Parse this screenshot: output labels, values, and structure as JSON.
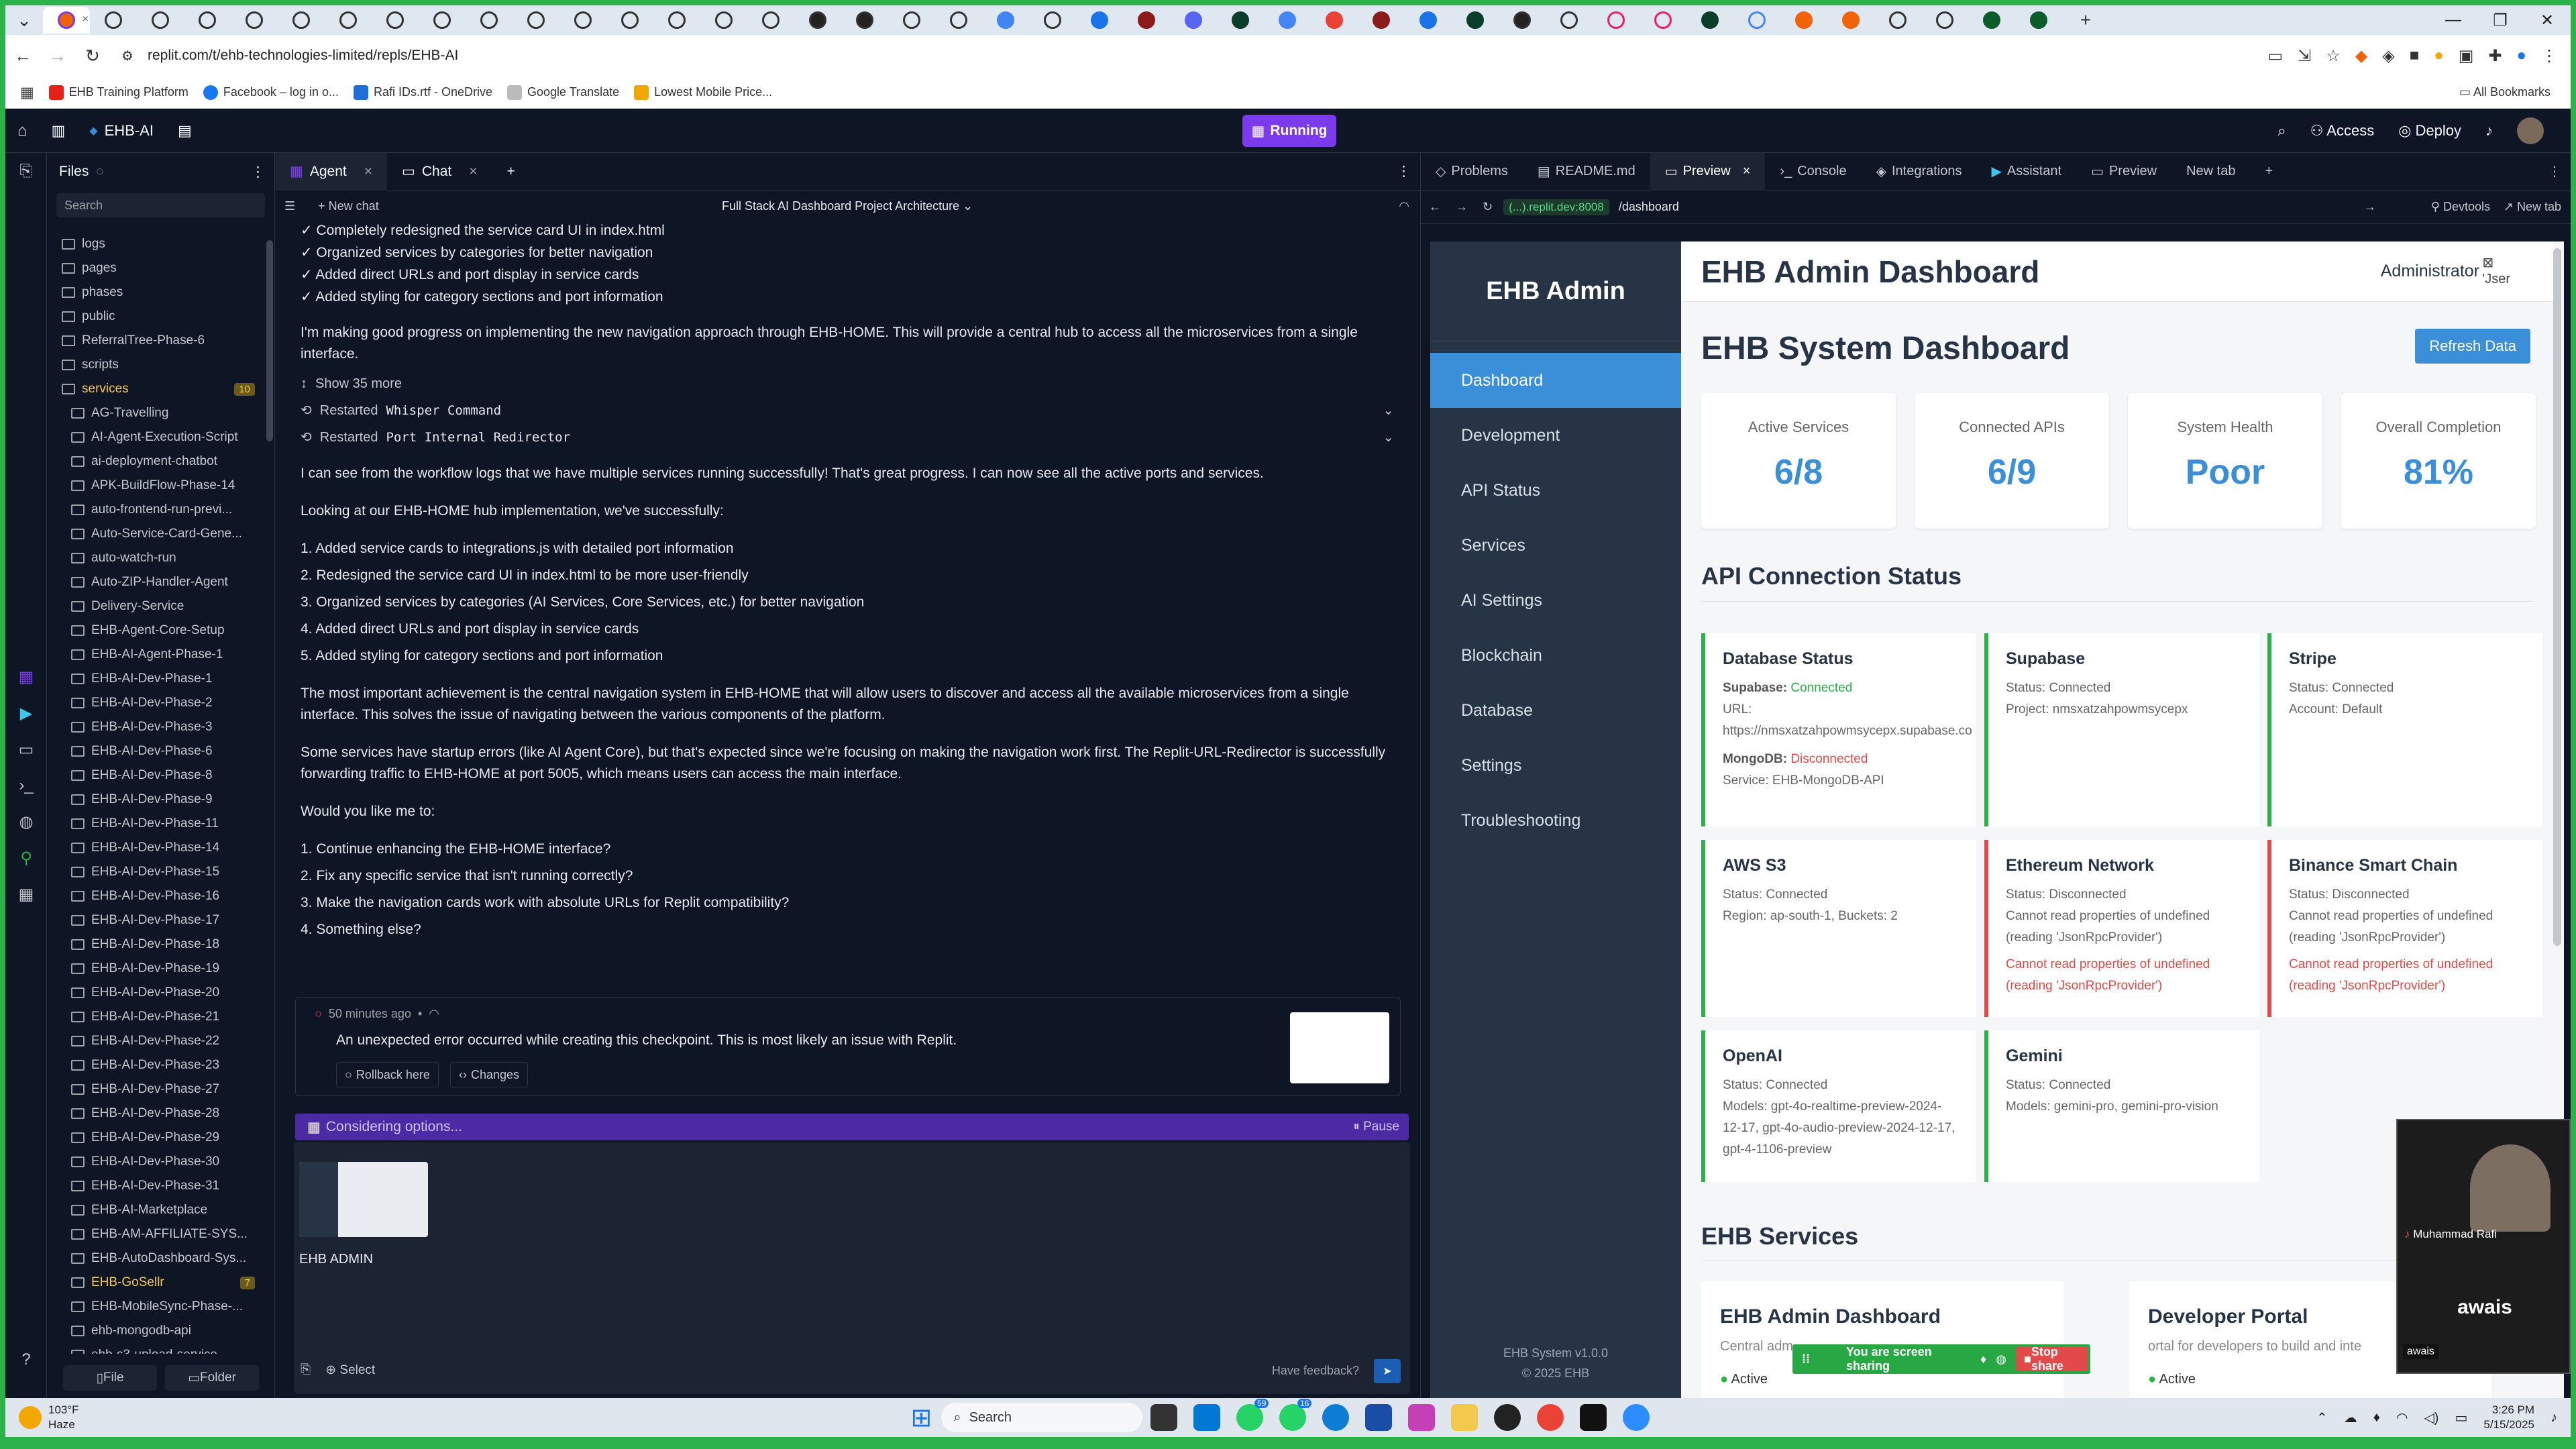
{
  "browser": {
    "url": "replit.com/t/ehb-technologies-limited/repls/EHB-AI",
    "bookmarks": [
      "EHB Training Platform",
      "Facebook – log in o...",
      "Rafi IDs.rtf - OneDrive",
      "Google Translate",
      "Lowest Mobile Price..."
    ],
    "all_bookmarks": "All Bookmarks"
  },
  "replit": {
    "project": "EHB-AI",
    "run_status": "Running",
    "access": "Access",
    "deploy": "Deploy"
  },
  "files": {
    "title": "Files",
    "search_placeholder": "Search",
    "file_btn": "File",
    "folder_btn": "Folder",
    "items": [
      {
        "name": "logs",
        "depth": 0
      },
      {
        "name": "pages",
        "depth": 0
      },
      {
        "name": "phases",
        "depth": 0
      },
      {
        "name": "public",
        "depth": 0
      },
      {
        "name": "ReferralTree-Phase-6",
        "depth": 0
      },
      {
        "name": "scripts",
        "depth": 0
      },
      {
        "name": "services",
        "depth": 0,
        "badge": "10",
        "highlight": true
      },
      {
        "name": "AG-Travelling",
        "depth": 1
      },
      {
        "name": "AI-Agent-Execution-Script",
        "depth": 1
      },
      {
        "name": "ai-deployment-chatbot",
        "depth": 1
      },
      {
        "name": "APK-BuildFlow-Phase-14",
        "depth": 1
      },
      {
        "name": "auto-frontend-run-previ...",
        "depth": 1
      },
      {
        "name": "Auto-Service-Card-Gene...",
        "depth": 1
      },
      {
        "name": "auto-watch-run",
        "depth": 1
      },
      {
        "name": "Auto-ZIP-Handler-Agent",
        "depth": 1
      },
      {
        "name": "Delivery-Service",
        "depth": 1
      },
      {
        "name": "EHB-Agent-Core-Setup",
        "depth": 1
      },
      {
        "name": "EHB-AI-Agent-Phase-1",
        "depth": 1
      },
      {
        "name": "EHB-AI-Dev-Phase-1",
        "depth": 1
      },
      {
        "name": "EHB-AI-Dev-Phase-2",
        "depth": 1
      },
      {
        "name": "EHB-AI-Dev-Phase-3",
        "depth": 1
      },
      {
        "name": "EHB-AI-Dev-Phase-6",
        "depth": 1
      },
      {
        "name": "EHB-AI-Dev-Phase-8",
        "depth": 1
      },
      {
        "name": "EHB-AI-Dev-Phase-9",
        "depth": 1
      },
      {
        "name": "EHB-AI-Dev-Phase-11",
        "depth": 1
      },
      {
        "name": "EHB-AI-Dev-Phase-14",
        "depth": 1
      },
      {
        "name": "EHB-AI-Dev-Phase-15",
        "depth": 1
      },
      {
        "name": "EHB-AI-Dev-Phase-16",
        "depth": 1
      },
      {
        "name": "EHB-AI-Dev-Phase-17",
        "depth": 1
      },
      {
        "name": "EHB-AI-Dev-Phase-18",
        "depth": 1
      },
      {
        "name": "EHB-AI-Dev-Phase-19",
        "depth": 1
      },
      {
        "name": "EHB-AI-Dev-Phase-20",
        "depth": 1
      },
      {
        "name": "EHB-AI-Dev-Phase-21",
        "depth": 1
      },
      {
        "name": "EHB-AI-Dev-Phase-22",
        "depth": 1
      },
      {
        "name": "EHB-AI-Dev-Phase-23",
        "depth": 1
      },
      {
        "name": "EHB-AI-Dev-Phase-27",
        "depth": 1
      },
      {
        "name": "EHB-AI-Dev-Phase-28",
        "depth": 1
      },
      {
        "name": "EHB-AI-Dev-Phase-29",
        "depth": 1
      },
      {
        "name": "EHB-AI-Dev-Phase-30",
        "depth": 1
      },
      {
        "name": "EHB-AI-Dev-Phase-31",
        "depth": 1
      },
      {
        "name": "EHB-AI-Marketplace",
        "depth": 1
      },
      {
        "name": "EHB-AM-AFFILIATE-SYS...",
        "depth": 1
      },
      {
        "name": "EHB-AutoDashboard-Sys...",
        "depth": 1
      },
      {
        "name": "EHB-GoSellr",
        "depth": 1,
        "badge": "7",
        "highlight": true
      },
      {
        "name": "EHB-MobileSync-Phase-...",
        "depth": 1
      },
      {
        "name": "ehb-mongodb-api",
        "depth": 1
      },
      {
        "name": "ehb-s3-upload-service",
        "depth": 1
      }
    ]
  },
  "agent": {
    "tab_agent": "Agent",
    "tab_chat": "Chat",
    "new_chat": "New chat",
    "thread_title": "Full Stack AI Dashboard Project Architecture",
    "checks": [
      "✓ Completely redesigned the service card UI in index.html",
      "✓ Organized services by categories for better navigation",
      "✓ Added direct URLs and port display in service cards",
      "✓ Added styling for category sections and port information"
    ],
    "p1": "I'm making good progress on implementing the new navigation approach through EHB-HOME. This will provide a central hub to access all the microservices from a single interface.",
    "show_more": "Show 35 more",
    "tool1_prefix": "Restarted",
    "tool1_code": "Whisper Command",
    "tool2_prefix": "Restarted",
    "tool2_code": "Port Internal Redirector",
    "p2": "I can see from the workflow logs that we have multiple services running successfully! That's great progress. I can now see all the active ports and services.",
    "p3": "Looking at our EHB-HOME hub implementation, we've successfully:",
    "list1": [
      "1. Added service cards to integrations.js with detailed port information",
      "2. Redesigned the service card UI in index.html to be more user-friendly",
      "3. Organized services by categories (AI Services, Core Services, etc.) for better navigation",
      "4. Added direct URLs and port display in service cards",
      "5. Added styling for category sections and port information"
    ],
    "p4": "The most important achievement is the central navigation system in EHB-HOME that will allow users to discover and access all the available microservices from a single interface. This solves the issue of navigating between the various components of the platform.",
    "p5": "Some services have startup errors (like AI Agent Core), but that's expected since we're focusing on making the navigation work first. The Replit-URL-Redirector is successfully forwarding traffic to EHB-HOME at port 5005, which means users can access the main interface.",
    "p6": "Would you like me to:",
    "list2": [
      "1. Continue enhancing the EHB-HOME interface?",
      "2. Fix any specific service that isn't running correctly?",
      "3. Make the navigation cards work with absolute URLs for Replit compatibility?",
      "4. Something else?"
    ],
    "ck_time": "50 minutes ago",
    "ck_error": "An unexpected error occurred while creating this checkpoint. This is most likely an issue with Replit.",
    "rollback": "Rollback here",
    "changes": "Changes",
    "considering": "Considering options...",
    "pause": "Pause",
    "attachment": "EHB ADMIN",
    "select": "Select",
    "feedback": "Have feedback?"
  },
  "preview": {
    "tabs": [
      "Problems",
      "README.md",
      "Preview",
      "Console",
      "Integrations",
      "Assistant",
      "Preview",
      "New tab"
    ],
    "host": "(...).replit.dev:8008",
    "path": "/dashboard",
    "devtools": "Devtools",
    "newtab": "New tab"
  },
  "site": {
    "brand": "EHB Admin",
    "nav": [
      "Dashboard",
      "Development",
      "API Status",
      "Services",
      "AI Settings",
      "Blockchain",
      "Database",
      "Settings",
      "Troubleshooting"
    ],
    "version": "EHB System v1.0.0",
    "copyright": "© 2025 EHB",
    "header": "EHB Admin Dashboard",
    "admin": "Administrator",
    "user_img_alt": "'Jser",
    "title": "EHB System Dashboard",
    "refresh": "Refresh Data",
    "stats": [
      {
        "label": "Active Services",
        "value": "6/8"
      },
      {
        "label": "Connected APIs",
        "value": "6/9"
      },
      {
        "label": "System Health",
        "value": "Poor"
      },
      {
        "label": "Overall Completion",
        "value": "81%"
      }
    ],
    "api_title": "API Connection Status",
    "db": {
      "name": "Database Status",
      "supa_label": "Supabase:",
      "supa_status": "Connected",
      "url_label": "URL:",
      "url": "https://nmsxatzahpowmsycepx.supabase.co",
      "mongo_label": "MongoDB:",
      "mongo_status": "Disconnected",
      "mongo_service": "Service: EHB-MongoDB-API"
    },
    "supabase": {
      "name": "Supabase",
      "l1": "Status: Connected",
      "l2": "Project: nmsxatzahpowmsycepx"
    },
    "stripe": {
      "name": "Stripe",
      "l1": "Status: Connected",
      "l2": "Account: Default"
    },
    "s3": {
      "name": "AWS S3",
      "l1": "Status: Connected",
      "l2": "Region: ap-south-1, Buckets: 2"
    },
    "eth": {
      "name": "Ethereum Network",
      "l1": "Status: Disconnected",
      "l2": "Cannot read properties of undefined (reading 'JsonRpcProvider')",
      "err": "Cannot read properties of undefined (reading 'JsonRpcProvider')"
    },
    "bsc": {
      "name": "Binance Smart Chain",
      "l1": "Status: Disconnected",
      "l2": "Cannot read properties of undefined (reading 'JsonRpcProvider')",
      "err": "Cannot read properties of undefined (reading 'JsonRpcProvider')"
    },
    "openai": {
      "name": "OpenAI",
      "l1": "Status: Connected",
      "l2": "Models: gpt-4o-realtime-preview-2024-12-17, gpt-4o-audio-preview-2024-12-17, gpt-4-1106-preview"
    },
    "gemini": {
      "name": "Gemini",
      "l1": "Status: Connected",
      "l2": "Models: gemini-pro, gemini-pro-vision"
    },
    "services_title": "EHB Services",
    "svc1": {
      "name": "EHB Admin Dashboard",
      "desc": "Central adm",
      "status": "Active"
    },
    "svc2": {
      "name": "Developer Portal",
      "desc": "ortal for developers to build and inte",
      "status": "Active"
    }
  },
  "share": {
    "text": "You are screen sharing",
    "stop": "Stop share"
  },
  "camera": {
    "caller": "Muhammad Rafi",
    "name": "awais",
    "label": "awais"
  },
  "taskbar": {
    "temp": "103°F",
    "weather": "Haze",
    "search": "Search",
    "time": "3:26 PM",
    "date": "5/15/2025",
    "badge1": "59",
    "badge2": "16"
  },
  "colors": {
    "accent": "#3a8fd8",
    "sidebar": "#263445",
    "running": "#7c3aed",
    "connected": "#2bb24a",
    "disconnected": "#e24a4a"
  }
}
